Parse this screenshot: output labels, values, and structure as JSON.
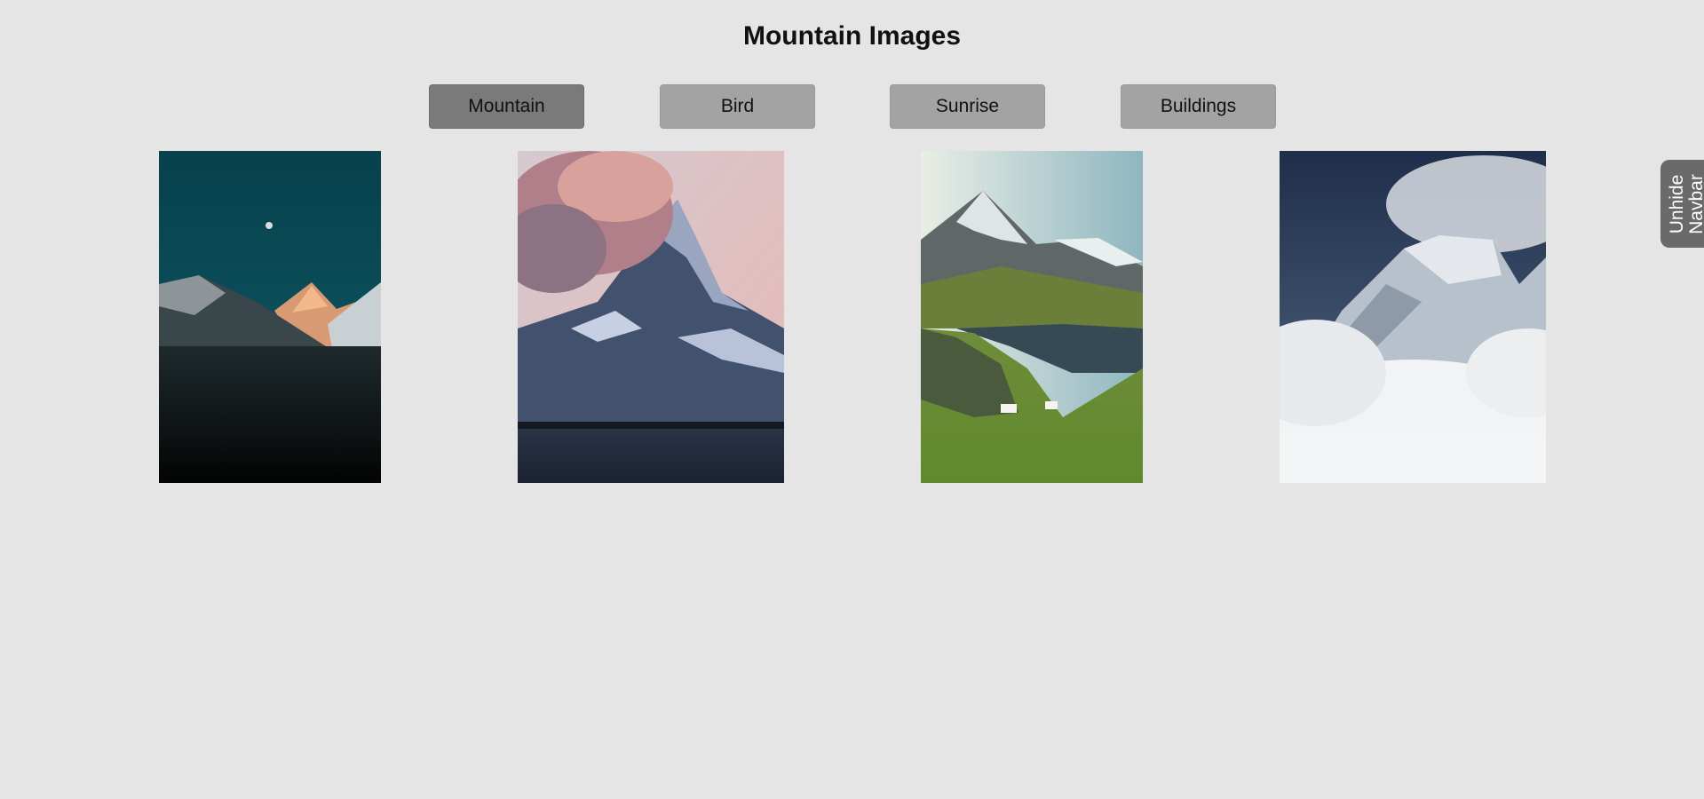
{
  "page": {
    "title": "Mountain Images"
  },
  "tabs": [
    {
      "label": "Mountain",
      "active": true
    },
    {
      "label": "Bird",
      "active": false
    },
    {
      "label": "Sunrise",
      "active": false
    },
    {
      "label": "Buildings",
      "active": false
    }
  ],
  "gallery": {
    "images": [
      {
        "subject": "snowy peaks under teal night sky with moon"
      },
      {
        "subject": "matterhorn-like peak with pink cloud above lake"
      },
      {
        "subject": "rocky peak above alpine lake and green meadow"
      },
      {
        "subject": "icy ridge emerging from clouds"
      }
    ]
  },
  "unhide_navbar": {
    "line1": "Unhide",
    "line2": "Navbar"
  },
  "colors": {
    "background": "#e5e5e5",
    "tab": "#a3a3a3",
    "tab_active": "#7a7a7a",
    "unhide_tab": "#6a6a6a"
  }
}
